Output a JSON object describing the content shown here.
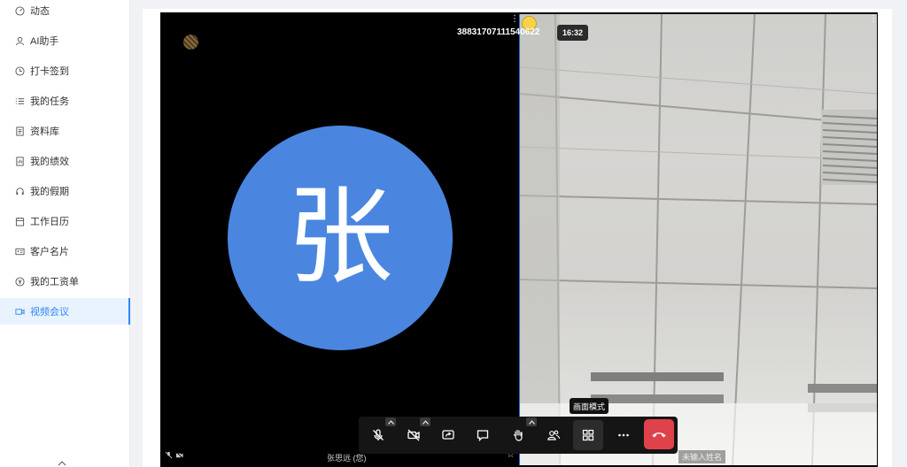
{
  "sidebar": {
    "items": [
      {
        "label": "动态",
        "icon": "dashboard-icon"
      },
      {
        "label": "AI助手",
        "icon": "user-icon"
      },
      {
        "label": "打卡签到",
        "icon": "clock-icon"
      },
      {
        "label": "我的任务",
        "icon": "list-icon"
      },
      {
        "label": "资料库",
        "icon": "document-icon"
      },
      {
        "label": "我的绩效",
        "icon": "report-icon"
      },
      {
        "label": "我的假期",
        "icon": "headphones-icon"
      },
      {
        "label": "工作日历",
        "icon": "calendar-icon"
      },
      {
        "label": "客户名片",
        "icon": "card-icon"
      },
      {
        "label": "我的工资单",
        "icon": "yen-icon"
      },
      {
        "label": "视频会议",
        "icon": "video-icon",
        "active": true
      }
    ]
  },
  "meeting": {
    "id": "38831707111540622",
    "time": "16:32",
    "local_name": "张思远 (您)",
    "remote_name": "未输入姓名",
    "avatar_char": "张"
  },
  "controls": {
    "tooltip": "画面模式",
    "buttons": [
      "mic-muted-icon",
      "camera-off-icon",
      "share-screen-icon",
      "chat-icon",
      "raise-hand-icon",
      "participants-icon",
      "layout-grid-icon",
      "more-icon",
      "hangup-icon"
    ]
  },
  "colors": {
    "accent": "#2f86f6",
    "avatar": "#4a86e0",
    "hangup": "#e0424b"
  }
}
